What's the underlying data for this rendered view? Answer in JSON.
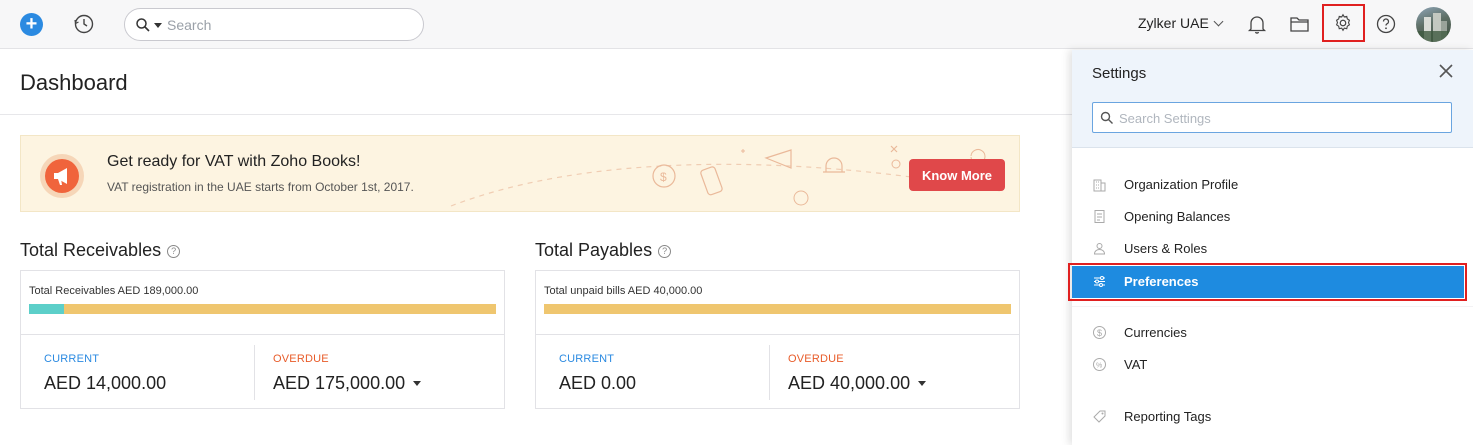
{
  "topbar": {
    "search_placeholder": "Search",
    "org_name": "Zylker UAE"
  },
  "dashboard": {
    "title": "Dashboard",
    "banner": {
      "title": "Get ready for VAT with Zoho Books!",
      "subtitle": "VAT registration in the UAE starts from October 1st, 2017.",
      "button_label": "Know More"
    },
    "receivables": {
      "title": "Total Receivables",
      "total_text": "Total Receivables AED 189,000.00",
      "current_fraction": 0.074,
      "current_label": "CURRENT",
      "current_amount": "AED 14,000.00",
      "overdue_label": "OVERDUE",
      "overdue_amount": "AED 175,000.00"
    },
    "payables": {
      "title": "Total Payables",
      "total_text": "Total unpaid bills AED 40,000.00",
      "current_fraction": 0.0,
      "current_label": "CURRENT",
      "current_amount": "AED 0.00",
      "overdue_label": "OVERDUE",
      "overdue_amount": "AED 40,000.00"
    }
  },
  "settings_panel": {
    "title": "Settings",
    "search_placeholder": "Search Settings",
    "items": [
      {
        "label": "Organization Profile",
        "icon": "building-icon"
      },
      {
        "label": "Opening Balances",
        "icon": "document-icon"
      },
      {
        "label": "Users & Roles",
        "icon": "users-icon"
      },
      {
        "label": "Preferences",
        "icon": "sliders-icon",
        "active": true
      },
      {
        "label": "Currencies",
        "icon": "currency-icon"
      },
      {
        "label": "VAT",
        "icon": "percent-icon"
      },
      {
        "label": "Reporting Tags",
        "icon": "tag-icon"
      }
    ]
  },
  "colors": {
    "accent": "#1e8be0",
    "highlight_outline": "#e02020",
    "banner_button": "#e0484a",
    "receivable_current_bar": "#5ccfc9",
    "receivable_overdue_bar": "#efc66f"
  }
}
